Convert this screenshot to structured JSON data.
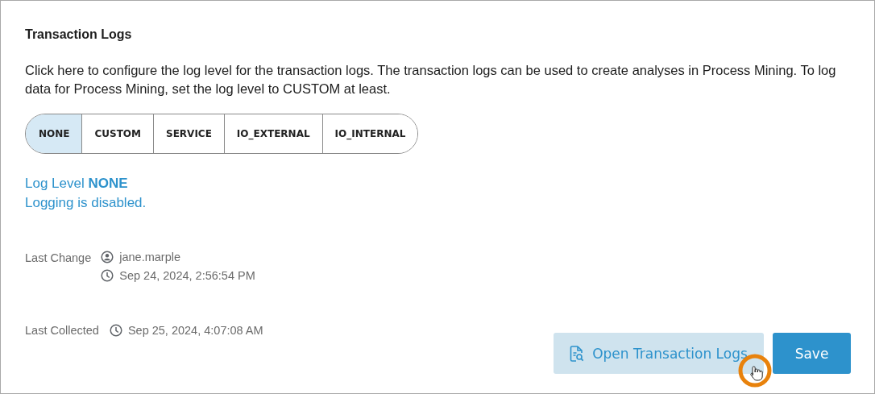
{
  "title": "Transaction Logs",
  "description": "Click here to configure the log level for the transaction logs. The transaction logs can be used to create analyses in Process Mining. To log data for Process Mining, set the log level to CUSTOM at least.",
  "levels": [
    {
      "label": "NONE",
      "selected": true
    },
    {
      "label": "CUSTOM",
      "selected": false
    },
    {
      "label": "SERVICE",
      "selected": false
    },
    {
      "label": "IO_EXTERNAL",
      "selected": false
    },
    {
      "label": "IO_INTERNAL",
      "selected": false
    }
  ],
  "status": {
    "label": "Log Level",
    "value": "NONE",
    "message": "Logging is disabled."
  },
  "last_change": {
    "label": "Last Change",
    "user": "jane.marple",
    "time": "Sep 24, 2024, 2:56:54 PM"
  },
  "last_collected": {
    "label": "Last Collected",
    "time": "Sep 25, 2024, 4:07:08 AM"
  },
  "buttons": [
    {
      "kind": "secondary",
      "label": "Open Transaction Logs"
    },
    {
      "kind": "primary",
      "label": "Save"
    }
  ]
}
